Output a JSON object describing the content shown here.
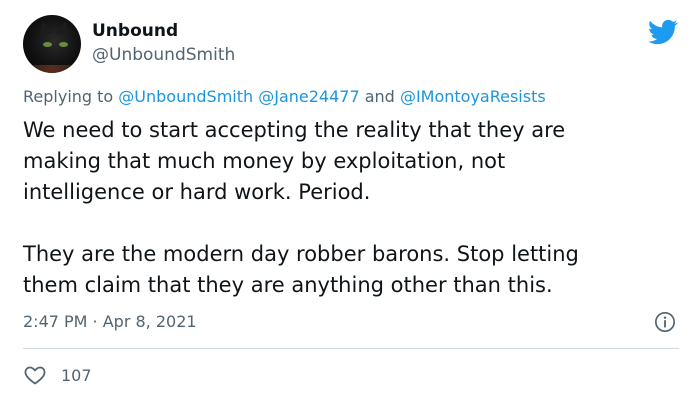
{
  "user": {
    "display_name": "Unbound",
    "handle": "@UnboundSmith",
    "avatar_icon": "black-cat-avatar"
  },
  "reply": {
    "prefix": "Replying to",
    "mentions": [
      "@UnboundSmith",
      "@Jane24477"
    ],
    "conjunction": "and",
    "last_mention": "@IMontoyaResists"
  },
  "tweet": {
    "paragraphs": [
      [
        "We need to start accepting the reality that they are",
        "making that much money by exploitation, not",
        "intelligence or hard work.  Period."
      ],
      [
        "They are the modern day robber barons.  Stop letting",
        "them claim that they are anything other than this."
      ]
    ],
    "timestamp": "2:47 PM · Apr 8, 2021"
  },
  "engagement": {
    "likes": "107",
    "like_icon": "heart-icon"
  },
  "brand": {
    "icon": "twitter-bird-icon",
    "color": "#1d9bf0"
  }
}
